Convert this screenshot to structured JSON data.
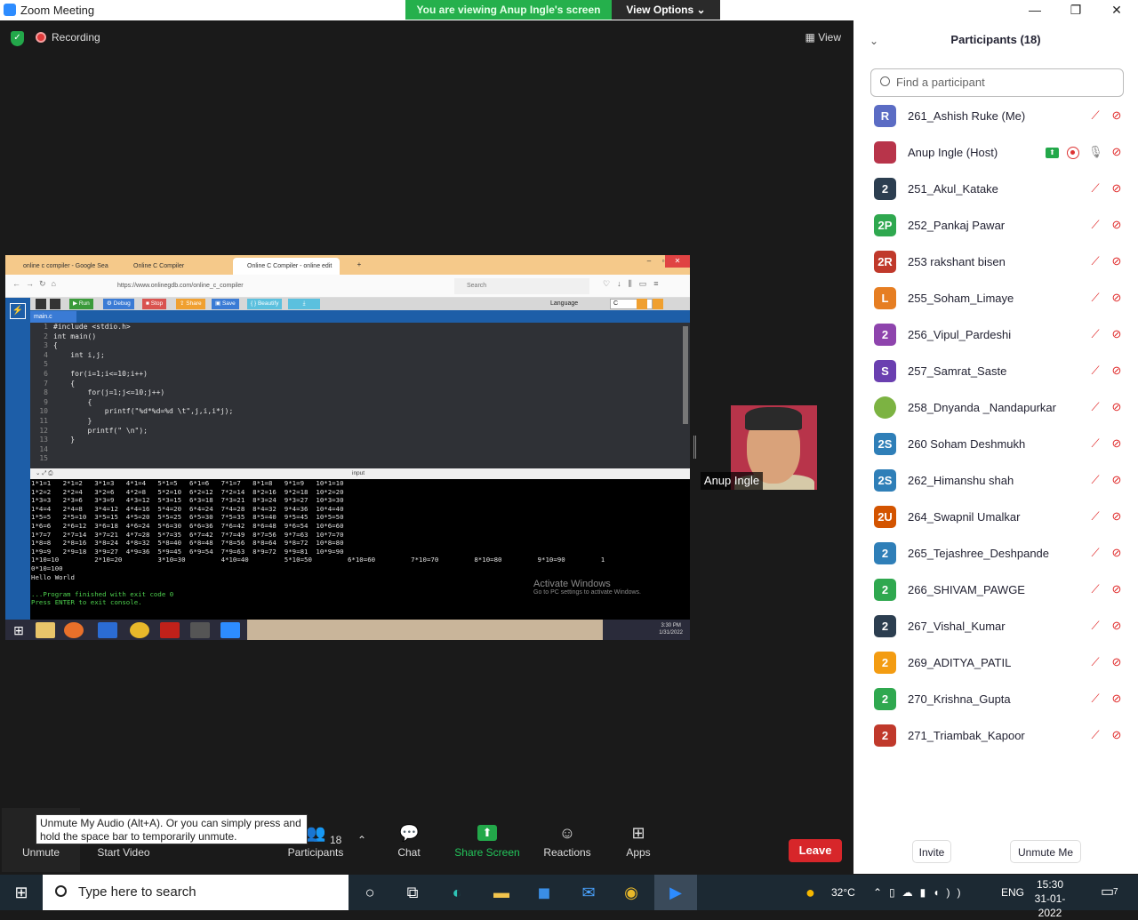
{
  "window": {
    "title": "Zoom Meeting",
    "viewing_banner": "You are viewing Anup Ingle's screen",
    "view_options": "View Options"
  },
  "topbar": {
    "recording": "Recording",
    "view": "View"
  },
  "shared_screen": {
    "browser_tabs": [
      "online c compiler - Google Sea",
      "Online C Compiler",
      "Online C Compiler - online edit"
    ],
    "url": "https://www.onlinegdb.com/online_c_compiler",
    "search_placeholder": "Search",
    "toolbar": [
      "Run",
      "Debug",
      "Stop",
      "Share",
      "Save",
      "{ } Beautify"
    ],
    "language_label": "Language",
    "language_value": "C",
    "file_tab": "main.c",
    "code_lines": [
      "#include <stdio.h>",
      "int main()",
      "{",
      "    int i,j;",
      "",
      "    for(i=1;i<=10;i++)",
      "    {",
      "        for(j=1;j<=10;j++)",
      "        {",
      "            printf(\"%d*%d=%d \\t\",j,i,i*j);",
      "        }",
      "        printf(\" \\n\");",
      "    }",
      "",
      ""
    ],
    "input_label": "input",
    "console_lines": [
      "1*1=1   2*1=2   3*1=3   4*1=4   5*1=5   6*1=6   7*1=7   8*1=8   9*1=9   10*1=10",
      "1*2=2   2*2=4   3*2=6   4*2=8   5*2=10  6*2=12  7*2=14  8*2=16  9*2=18  10*2=20",
      "1*3=3   2*3=6   3*3=9   4*3=12  5*3=15  6*3=18  7*3=21  8*3=24  9*3=27  10*3=30",
      "1*4=4   2*4=8   3*4=12  4*4=16  5*4=20  6*4=24  7*4=28  8*4=32  9*4=36  10*4=40",
      "1*5=5   2*5=10  3*5=15  4*5=20  5*5=25  6*5=30  7*5=35  8*5=40  9*5=45  10*5=50",
      "1*6=6   2*6=12  3*6=18  4*6=24  5*6=30  6*6=36  7*6=42  8*6=48  9*6=54  10*6=60",
      "1*7=7   2*7=14  3*7=21  4*7=28  5*7=35  6*7=42  7*7=49  8*7=56  9*7=63  10*7=70",
      "1*8=8   2*8=16  3*8=24  4*8=32  5*8=40  6*8=48  7*8=56  8*8=64  9*8=72  10*8=80",
      "1*9=9   2*9=18  3*9=27  4*9=36  5*9=45  6*9=54  7*9=63  8*9=72  9*9=81  10*9=90",
      "1*10=10         2*10=20         3*10=30         4*10=40         5*10=50         6*10=60         7*10=70         8*10=80         9*10=90         1",
      "0*10=100",
      "Hello World",
      "",
      "...Program finished with exit code 0",
      "Press ENTER to exit console."
    ],
    "activate_title": "Activate Windows",
    "activate_sub": "Go to PC settings to activate Windows.",
    "inner_clock_time": "3:30 PM",
    "inner_clock_date": "1/31/2022"
  },
  "video": {
    "name": "Anup Ingle"
  },
  "controls": {
    "unmute": "Unmute",
    "start_video": "Start Video",
    "participants": "Participants",
    "participants_count": "18",
    "chat": "Chat",
    "share_screen": "Share Screen",
    "reactions": "Reactions",
    "apps": "Apps",
    "leave": "Leave",
    "tooltip": "Unmute My Audio (Alt+A). Or you can simply press and hold the space bar to temporarily unmute."
  },
  "panel": {
    "title": "Participants (18)",
    "search_placeholder": "Find a participant",
    "invite": "Invite",
    "unmute_me": "Unmute Me",
    "participants": [
      {
        "initials": "R",
        "name": "261_Ashish Ruke (Me)",
        "color": "#5b6cc4"
      },
      {
        "initials": "",
        "name": "Anup Ingle (Host)",
        "color": "#b8344a",
        "photo": true
      },
      {
        "initials": "2",
        "name": "251_Akul_Katake",
        "color": "#2c3e50"
      },
      {
        "initials": "2P",
        "name": "252_Pankaj Pawar",
        "color": "#2fa84f"
      },
      {
        "initials": "2R",
        "name": "253 rakshant bisen",
        "color": "#c0392b"
      },
      {
        "initials": "L",
        "name": "255_Soham_Limaye",
        "color": "#e67e22"
      },
      {
        "initials": "2",
        "name": "256_Vipul_Pardeshi",
        "color": "#8e44ad"
      },
      {
        "initials": "S",
        "name": "257_Samrat_Saste",
        "color": "#6a3fb0"
      },
      {
        "initials": "",
        "name": "258_Dnyanda _Nandapurkar",
        "color": "#7cb342",
        "avatar": true
      },
      {
        "initials": "2S",
        "name": "260 Soham Deshmukh",
        "color": "#2f7fb8"
      },
      {
        "initials": "2S",
        "name": "262_Himanshu shah",
        "color": "#2f7fb8"
      },
      {
        "initials": "2U",
        "name": "264_Swapnil Umalkar",
        "color": "#d35400"
      },
      {
        "initials": "2",
        "name": "265_Tejashree_Deshpande",
        "color": "#2f7fb8"
      },
      {
        "initials": "2",
        "name": "266_SHIVAM_PAWGE",
        "color": "#2fa84f"
      },
      {
        "initials": "2",
        "name": "267_Vishal_Kumar",
        "color": "#2c3e50"
      },
      {
        "initials": "2",
        "name": "269_ADITYA_PATIL",
        "color": "#f39c12"
      },
      {
        "initials": "2",
        "name": "270_Krishna_Gupta",
        "color": "#2fa84f"
      },
      {
        "initials": "2",
        "name": "271_Triambak_Kapoor",
        "color": "#c0392b"
      }
    ]
  },
  "taskbar": {
    "search_placeholder": "Type here to search",
    "temperature": "32°C",
    "language": "ENG",
    "time": "15:30",
    "date": "31-01-2022",
    "notification_count": "7"
  }
}
